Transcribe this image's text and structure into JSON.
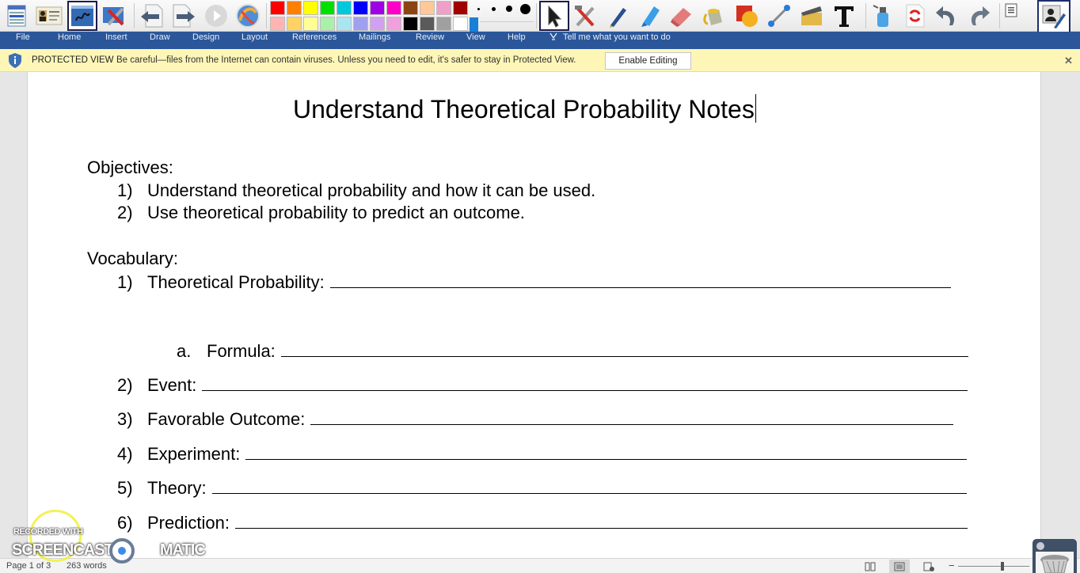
{
  "toolbar": {
    "tools_left": [
      {
        "name": "menu-tool-icon",
        "tooltip": ""
      },
      {
        "name": "id-card-icon",
        "tooltip": ""
      },
      {
        "name": "whiteboard-pen-icon",
        "tooltip": "",
        "active": true
      },
      {
        "name": "tools-settings-icon",
        "tooltip": ""
      },
      {
        "name": "previous-page-icon",
        "tooltip": ""
      },
      {
        "name": "next-page-icon",
        "tooltip": ""
      },
      {
        "name": "play-icon",
        "tooltip": ""
      },
      {
        "name": "help-globe-icon",
        "tooltip": ""
      }
    ],
    "palette_top": [
      "#ff0000",
      "#ff8000",
      "#ffff00",
      "#00e000",
      "#00c8dc",
      "#0000ff",
      "#a000e6",
      "#ff00c8",
      "#8b4513",
      "#ffc896",
      "#f0a0c8",
      "#a00000"
    ],
    "palette_bottom": [
      "#ffb4b4",
      "#ffd264",
      "#ffff96",
      "#aaf0aa",
      "#aae6f0",
      "#a0a0f0",
      "#d2a0f0",
      "#f0a0dc",
      "#000000",
      "#5a5a5a",
      "#a0a0a0",
      "#ffffff"
    ],
    "accent_color": "#1a7fd6",
    "pen_sizes": [
      "tiny",
      "small",
      "medium",
      "large"
    ],
    "tools_right": [
      {
        "name": "pointer-arrow-icon",
        "active": true
      },
      {
        "name": "hammer-wrench-icon"
      },
      {
        "name": "pen-icon"
      },
      {
        "name": "highlighter-icon"
      },
      {
        "name": "eraser-icon"
      },
      {
        "name": "paint-bucket-icon"
      },
      {
        "name": "shapes-icon"
      },
      {
        "name": "line-tool-icon"
      },
      {
        "name": "clapperboard-icon"
      },
      {
        "name": "text-tool-icon"
      },
      {
        "name": "spray-clear-icon"
      },
      {
        "name": "refresh-page-icon"
      },
      {
        "name": "undo-icon"
      },
      {
        "name": "redo-icon"
      },
      {
        "name": "page-list-icon"
      },
      {
        "name": "user-pen-icon"
      }
    ]
  },
  "ribbon": {
    "tabs": [
      "File",
      "Home",
      "Insert",
      "Draw",
      "Design",
      "Layout",
      "References",
      "Mailings",
      "Review",
      "View",
      "Help"
    ],
    "tell_me": "Tell me what you want to do"
  },
  "protected_view": {
    "label": "PROTECTED VIEW",
    "message": "Be careful—files from the Internet can contain viruses. Unless you need to edit, it's safer to stay in Protected View.",
    "button": "Enable Editing",
    "close": "✕"
  },
  "document": {
    "title": "Understand Theoretical Probability Notes",
    "objectives_heading": "Objectives:",
    "objectives": [
      {
        "num": "1)",
        "text": "Understand theoretical probability and how it can be used."
      },
      {
        "num": "2)",
        "text": "Use theoretical probability to predict an outcome."
      }
    ],
    "vocabulary_heading": "Vocabulary:",
    "vocabulary": [
      {
        "num": "1)",
        "text": "Theoretical Probability:"
      },
      {
        "num": "a.",
        "text": "Formula:"
      },
      {
        "num": "2)",
        "text": "Event:"
      },
      {
        "num": "3)",
        "text": "Favorable Outcome:"
      },
      {
        "num": "4)",
        "text": "Experiment:"
      },
      {
        "num": "5)",
        "text": "Theory:"
      },
      {
        "num": "6)",
        "text": "Prediction:"
      }
    ]
  },
  "status": {
    "page": "Page 1 of 3",
    "words": "263 words"
  },
  "watermark": {
    "line1": "RECORDED WITH",
    "line2a": "SCREENCAST",
    "line2b": "MATIC"
  }
}
